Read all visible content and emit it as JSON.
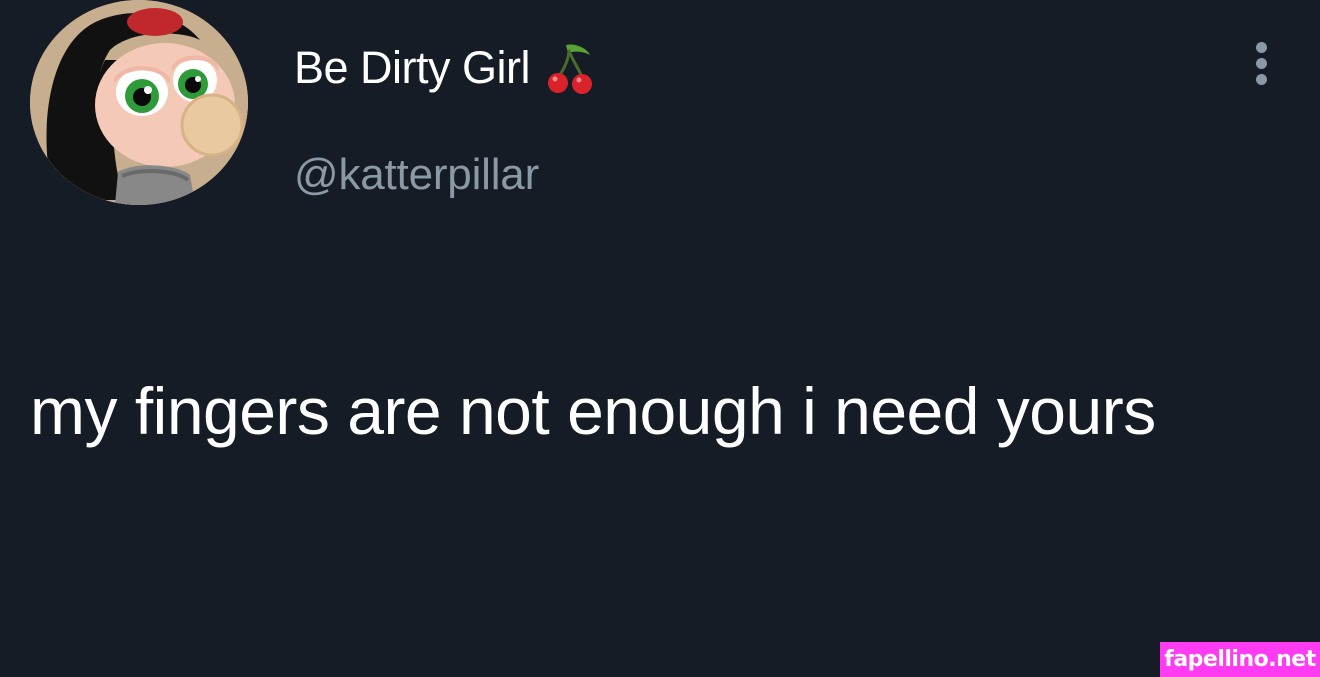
{
  "tweet": {
    "display_name": "Be Dirty Girl",
    "name_emoji_icon": "cherry-icon",
    "handle": "@katterpillar",
    "text": "my fingers are not enough i need yours",
    "more_options_icon": "more-vertical-icon"
  },
  "watermark": {
    "text": "fapellino.net"
  },
  "colors": {
    "background": "#151c25",
    "primary_text": "#ffffff",
    "secondary_text": "#8b98a5",
    "watermark_bg": "#ff3cf2"
  }
}
